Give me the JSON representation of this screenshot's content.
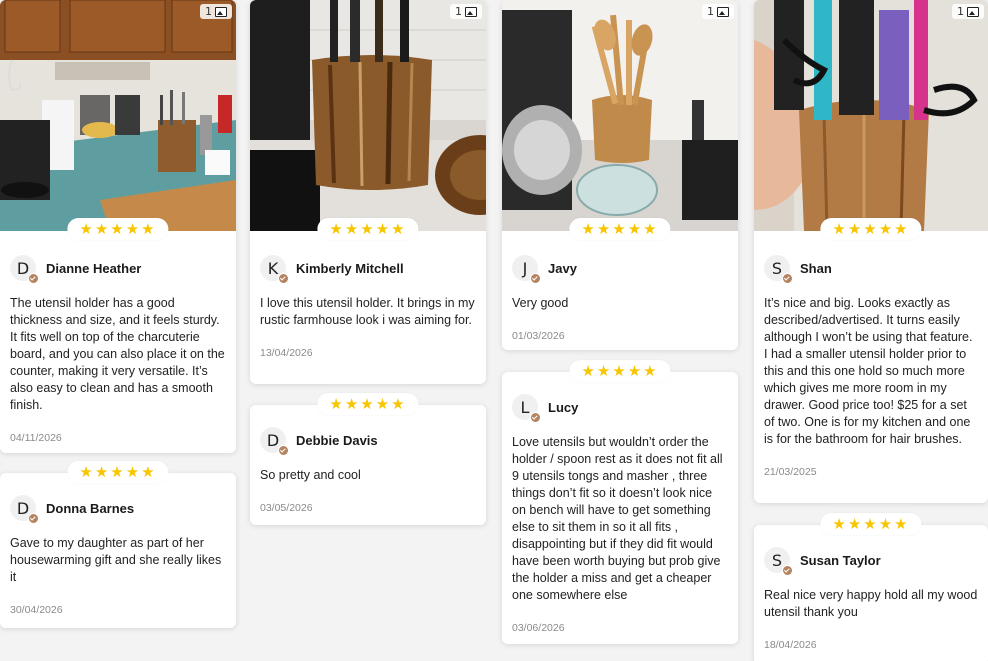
{
  "photo_count": "1",
  "stars": "★★★★★",
  "reviews": {
    "dianne": {
      "initial": "D",
      "name": "Dianne Heather",
      "text": "The utensil holder has a good thickness and size, and it feels sturdy. It fits well on top of the charcuterie board, and you can also place it on the counter, making it very versatile. It’s also easy to clean and has a smooth finish.",
      "date": "04/11/2026"
    },
    "donna": {
      "initial": "D",
      "name": "Donna Barnes",
      "text": "Gave to my daughter as part of her housewarming gift and she really likes it",
      "date": "30/04/2026"
    },
    "kimberly": {
      "initial": "K",
      "name": "Kimberly Mitchell",
      "text": "I love this utensil holder. It brings in my rustic farmhouse look i was aiming for.",
      "date": "13/04/2026"
    },
    "debbie": {
      "initial": "D",
      "name": "Debbie Davis",
      "text": "So pretty and cool",
      "date": "03/05/2026"
    },
    "javy": {
      "initial": "J",
      "name": "Javy",
      "text": "Very good",
      "date": "01/03/2026"
    },
    "lucy": {
      "initial": "L",
      "name": "Lucy",
      "text": "Love utensils but wouldn’t order the holder / spoon rest as it does not fit all 9 utensils tongs and masher , three things don’t fit so it doesn’t look nice on bench will have to get something else to sit them in so it all fits , disappointing but if they did fit would have been worth buying but prob give the holder a miss and get a cheaper one somewhere else",
      "date": "03/06/2026"
    },
    "shan": {
      "initial": "S",
      "name": "Shan",
      "text": "It’s nice and big. Looks exactly as described/advertised. It turns easily although I won’t be using that feature. I had a smaller utensil holder prior to this and this one hold so much more which gives me more room in my drawer. Good price too! $25 for a set of two. One is for my kitchen and one is for the bathroom for hair brushes.",
      "date": "21/03/2025"
    },
    "susan": {
      "initial": "S",
      "name": "Susan Taylor",
      "text": "Real nice very happy hold all my wood utensil thank you",
      "date": "18/04/2026"
    }
  }
}
